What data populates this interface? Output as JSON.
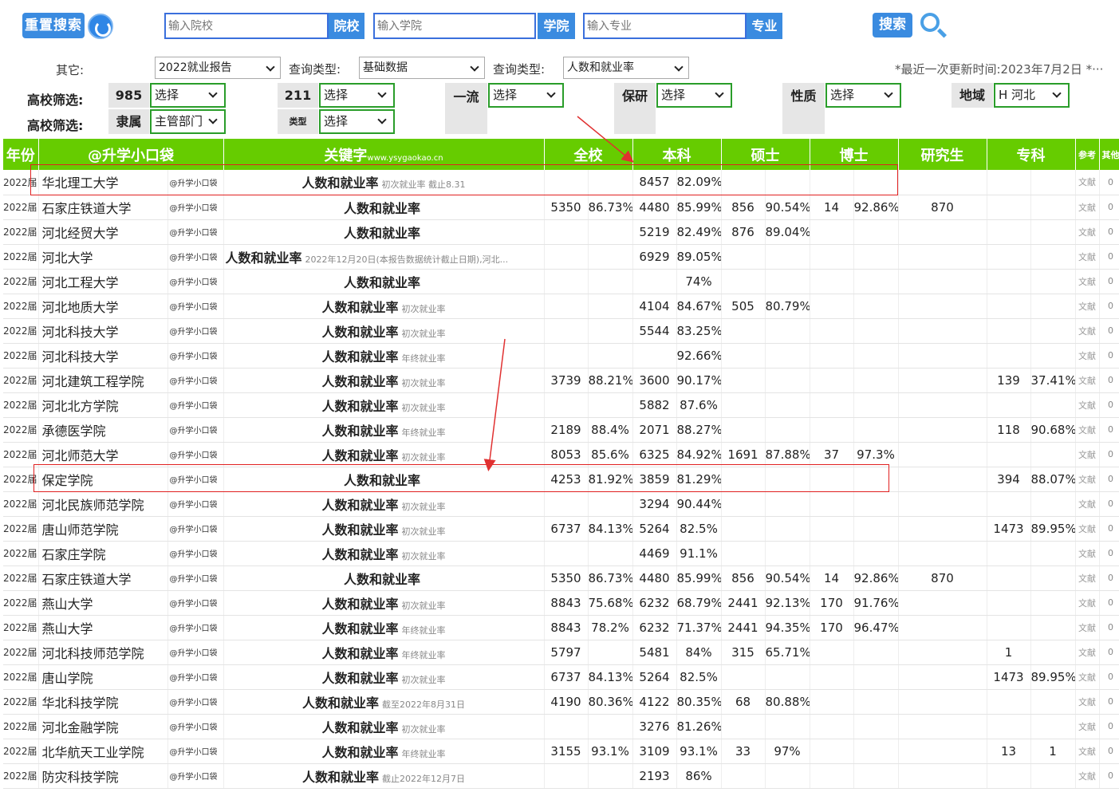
{
  "search": {
    "reset_label": "重置搜索",
    "school_placeholder": "输入院校",
    "school_tag": "院校",
    "college_placeholder": "输入学院",
    "college_tag": "学院",
    "major_placeholder": "输入专业",
    "major_tag": "专业",
    "search_label": "搜索"
  },
  "filters1": {
    "other_label": "其它:",
    "other_value": "2022就业报告",
    "qtype1_label": "查询类型:",
    "qtype1_value": "基础数据",
    "qtype2_label": "查询类型:",
    "qtype2_value": "人数和就业率",
    "update_note": "*最近一次更新时间:2023年7月2日 *···"
  },
  "filters2": {
    "label1": "高校筛选:",
    "label2": "高校筛选:",
    "t985": "985",
    "t211": "211",
    "tfirst": "一流",
    "tbaoyan": "保研",
    "txingzhi": "性质",
    "tregion": "地域",
    "tlishu": "隶属",
    "tleixing": "类型",
    "select": "选择",
    "region_value": "H 河北",
    "lishu_value": "主管部门"
  },
  "table": {
    "headers": {
      "year": "年份",
      "source": "@升学小口袋",
      "keyword": "关键字",
      "keyword_url": "www.ysygaokao.cn",
      "all": "全校",
      "ben": "本科",
      "shuo": "硕士",
      "bo": "博士",
      "yjs": "研究生",
      "zhuan": "专科",
      "ref": "参考",
      "other": "其他"
    },
    "rows": [
      {
        "y": "2022届",
        "n": "华北理工大学",
        "s": "@升学小口袋",
        "k": "人数和就业率",
        "kn": "初次就业率 截止8.31",
        "a1": "",
        "a2": "",
        "b1": "8457",
        "b2": "82.09%",
        "c1": "",
        "c2": "",
        "d1": "",
        "d2": "",
        "e1": "",
        "f1": "",
        "f2": "",
        "r": "文献",
        "o": "0"
      },
      {
        "y": "2022届",
        "n": "石家庄铁道大学",
        "s": "@升学小口袋",
        "k": "人数和就业率",
        "kn": "",
        "a1": "5350",
        "a2": "86.73%",
        "b1": "4480",
        "b2": "85.99%",
        "c1": "856",
        "c2": "90.54%",
        "d1": "14",
        "d2": "92.86%",
        "e1": "870",
        "f1": "",
        "f2": "",
        "r": "文献",
        "o": "0"
      },
      {
        "y": "2022届",
        "n": "河北经贸大学",
        "s": "@升学小口袋",
        "k": "人数和就业率",
        "kn": "",
        "a1": "",
        "a2": "",
        "b1": "5219",
        "b2": "82.49%",
        "c1": "876",
        "c2": "89.04%",
        "d1": "",
        "d2": "",
        "e1": "",
        "f1": "",
        "f2": "",
        "r": "文献",
        "o": "0"
      },
      {
        "y": "2022届",
        "n": "河北大学",
        "s": "@升学小口袋",
        "k": "人数和就业率",
        "kn": "2022年12月20日(本报告数据统计截止日期),河北...",
        "a1": "",
        "a2": "",
        "b1": "6929",
        "b2": "89.05%",
        "c1": "",
        "c2": "",
        "d1": "",
        "d2": "",
        "e1": "",
        "f1": "",
        "f2": "",
        "r": "文献",
        "o": "0"
      },
      {
        "y": "2022届",
        "n": "河北工程大学",
        "s": "@升学小口袋",
        "k": "人数和就业率",
        "kn": "",
        "a1": "",
        "a2": "",
        "b1": "",
        "b2": "74%",
        "c1": "",
        "c2": "",
        "d1": "",
        "d2": "",
        "e1": "",
        "f1": "",
        "f2": "",
        "r": "文献",
        "o": "0"
      },
      {
        "y": "2022届",
        "n": "河北地质大学",
        "s": "@升学小口袋",
        "k": "人数和就业率",
        "kn": "初次就业率",
        "a1": "",
        "a2": "",
        "b1": "4104",
        "b2": "84.67%",
        "c1": "505",
        "c2": "80.79%",
        "d1": "",
        "d2": "",
        "e1": "",
        "f1": "",
        "f2": "",
        "r": "文献",
        "o": "0"
      },
      {
        "y": "2022届",
        "n": "河北科技大学",
        "s": "@升学小口袋",
        "k": "人数和就业率",
        "kn": "初次就业率",
        "a1": "",
        "a2": "",
        "b1": "5544",
        "b2": "83.25%",
        "c1": "",
        "c2": "",
        "d1": "",
        "d2": "",
        "e1": "",
        "f1": "",
        "f2": "",
        "r": "文献",
        "o": "0"
      },
      {
        "y": "2022届",
        "n": "河北科技大学",
        "s": "@升学小口袋",
        "k": "人数和就业率",
        "kn": "年终就业率",
        "a1": "",
        "a2": "",
        "b1": "",
        "b2": "92.66%",
        "c1": "",
        "c2": "",
        "d1": "",
        "d2": "",
        "e1": "",
        "f1": "",
        "f2": "",
        "r": "文献",
        "o": "0"
      },
      {
        "y": "2022届",
        "n": "河北建筑工程学院",
        "s": "@升学小口袋",
        "k": "人数和就业率",
        "kn": "初次就业率",
        "a1": "3739",
        "a2": "88.21%",
        "b1": "3600",
        "b2": "90.17%",
        "c1": "",
        "c2": "",
        "d1": "",
        "d2": "",
        "e1": "",
        "f1": "139",
        "f2": "37.41%",
        "r": "文献",
        "o": "0"
      },
      {
        "y": "2022届",
        "n": "河北北方学院",
        "s": "@升学小口袋",
        "k": "人数和就业率",
        "kn": "初次就业率",
        "a1": "",
        "a2": "",
        "b1": "5882",
        "b2": "87.6%",
        "c1": "",
        "c2": "",
        "d1": "",
        "d2": "",
        "e1": "",
        "f1": "",
        "f2": "",
        "r": "文献",
        "o": "0"
      },
      {
        "y": "2022届",
        "n": "承德医学院",
        "s": "@升学小口袋",
        "k": "人数和就业率",
        "kn": "年终就业率",
        "a1": "2189",
        "a2": "88.4%",
        "b1": "2071",
        "b2": "88.27%",
        "c1": "",
        "c2": "",
        "d1": "",
        "d2": "",
        "e1": "",
        "f1": "118",
        "f2": "90.68%",
        "r": "文献",
        "o": "0"
      },
      {
        "y": "2022届",
        "n": "河北师范大学",
        "s": "@升学小口袋",
        "k": "人数和就业率",
        "kn": "初次就业率",
        "a1": "8053",
        "a2": "85.6%",
        "b1": "6325",
        "b2": "84.92%",
        "c1": "1691",
        "c2": "87.88%",
        "d1": "37",
        "d2": "97.3%",
        "e1": "",
        "f1": "",
        "f2": "",
        "r": "文献",
        "o": "0"
      },
      {
        "y": "2022届",
        "n": "保定学院",
        "s": "@升学小口袋",
        "k": "人数和就业率",
        "kn": "",
        "a1": "4253",
        "a2": "81.92%",
        "b1": "3859",
        "b2": "81.29%",
        "c1": "",
        "c2": "",
        "d1": "",
        "d2": "",
        "e1": "",
        "f1": "394",
        "f2": "88.07%",
        "r": "文献",
        "o": "0"
      },
      {
        "y": "2022届",
        "n": "河北民族师范学院",
        "s": "@升学小口袋",
        "k": "人数和就业率",
        "kn": "初次就业率",
        "a1": "",
        "a2": "",
        "b1": "3294",
        "b2": "90.44%",
        "c1": "",
        "c2": "",
        "d1": "",
        "d2": "",
        "e1": "",
        "f1": "",
        "f2": "",
        "r": "文献",
        "o": "0"
      },
      {
        "y": "2022届",
        "n": "唐山师范学院",
        "s": "@升学小口袋",
        "k": "人数和就业率",
        "kn": "初次就业率",
        "a1": "6737",
        "a2": "84.13%",
        "b1": "5264",
        "b2": "82.5%",
        "c1": "",
        "c2": "",
        "d1": "",
        "d2": "",
        "e1": "",
        "f1": "1473",
        "f2": "89.95%",
        "r": "文献",
        "o": "0"
      },
      {
        "y": "2022届",
        "n": "石家庄学院",
        "s": "@升学小口袋",
        "k": "人数和就业率",
        "kn": "初次就业率",
        "a1": "",
        "a2": "",
        "b1": "4469",
        "b2": "91.1%",
        "c1": "",
        "c2": "",
        "d1": "",
        "d2": "",
        "e1": "",
        "f1": "",
        "f2": "",
        "r": "文献",
        "o": "0"
      },
      {
        "y": "2022届",
        "n": "石家庄铁道大学",
        "s": "@升学小口袋",
        "k": "人数和就业率",
        "kn": "",
        "a1": "5350",
        "a2": "86.73%",
        "b1": "4480",
        "b2": "85.99%",
        "c1": "856",
        "c2": "90.54%",
        "d1": "14",
        "d2": "92.86%",
        "e1": "870",
        "f1": "",
        "f2": "",
        "r": "文献",
        "o": "0"
      },
      {
        "y": "2022届",
        "n": "燕山大学",
        "s": "@升学小口袋",
        "k": "人数和就业率",
        "kn": "初次就业率",
        "a1": "8843",
        "a2": "75.68%",
        "b1": "6232",
        "b2": "68.79%",
        "c1": "2441",
        "c2": "92.13%",
        "d1": "170",
        "d2": "91.76%",
        "e1": "",
        "f1": "",
        "f2": "",
        "r": "文献",
        "o": "0"
      },
      {
        "y": "2022届",
        "n": "燕山大学",
        "s": "@升学小口袋",
        "k": "人数和就业率",
        "kn": "年终就业率",
        "a1": "8843",
        "a2": "78.2%",
        "b1": "6232",
        "b2": "71.37%",
        "c1": "2441",
        "c2": "94.35%",
        "d1": "170",
        "d2": "96.47%",
        "e1": "",
        "f1": "",
        "f2": "",
        "r": "文献",
        "o": "0"
      },
      {
        "y": "2022届",
        "n": "河北科技师范学院",
        "s": "@升学小口袋",
        "k": "人数和就业率",
        "kn": "年终就业率",
        "a1": "5797",
        "a2": "",
        "b1": "5481",
        "b2": "84%",
        "c1": "315",
        "c2": "65.71%",
        "d1": "",
        "d2": "",
        "e1": "",
        "f1": "1",
        "f2": "",
        "r": "文献",
        "o": "0"
      },
      {
        "y": "2022届",
        "n": "唐山学院",
        "s": "@升学小口袋",
        "k": "人数和就业率",
        "kn": "初次就业率",
        "a1": "6737",
        "a2": "84.13%",
        "b1": "5264",
        "b2": "82.5%",
        "c1": "",
        "c2": "",
        "d1": "",
        "d2": "",
        "e1": "",
        "f1": "1473",
        "f2": "89.95%",
        "r": "文献",
        "o": "0"
      },
      {
        "y": "2022届",
        "n": "华北科技学院",
        "s": "@升学小口袋",
        "k": "人数和就业率",
        "kn": "截至2022年8月31日",
        "a1": "4190",
        "a2": "80.36%",
        "b1": "4122",
        "b2": "80.35%",
        "c1": "68",
        "c2": "80.88%",
        "d1": "",
        "d2": "",
        "e1": "",
        "f1": "",
        "f2": "",
        "r": "文献",
        "o": "0"
      },
      {
        "y": "2022届",
        "n": "河北金融学院",
        "s": "@升学小口袋",
        "k": "人数和就业率",
        "kn": "初次就业率",
        "a1": "",
        "a2": "",
        "b1": "3276",
        "b2": "81.26%",
        "c1": "",
        "c2": "",
        "d1": "",
        "d2": "",
        "e1": "",
        "f1": "",
        "f2": "",
        "r": "文献",
        "o": "0"
      },
      {
        "y": "2022届",
        "n": "北华航天工业学院",
        "s": "@升学小口袋",
        "k": "人数和就业率",
        "kn": "年终就业率",
        "a1": "3155",
        "a2": "93.1%",
        "b1": "3109",
        "b2": "93.1%",
        "c1": "33",
        "c2": "97%",
        "d1": "",
        "d2": "",
        "e1": "",
        "f1": "13",
        "f2": "1",
        "r": "文献",
        "o": "0"
      },
      {
        "y": "2022届",
        "n": "防灾科技学院",
        "s": "@升学小口袋",
        "k": "人数和就业率",
        "kn": "截止2022年12月7日",
        "a1": "",
        "a2": "",
        "b1": "2193",
        "b2": "86%",
        "c1": "",
        "c2": "",
        "d1": "",
        "d2": "",
        "e1": "",
        "f1": "",
        "f2": "",
        "r": "文献",
        "o": "0"
      }
    ]
  }
}
